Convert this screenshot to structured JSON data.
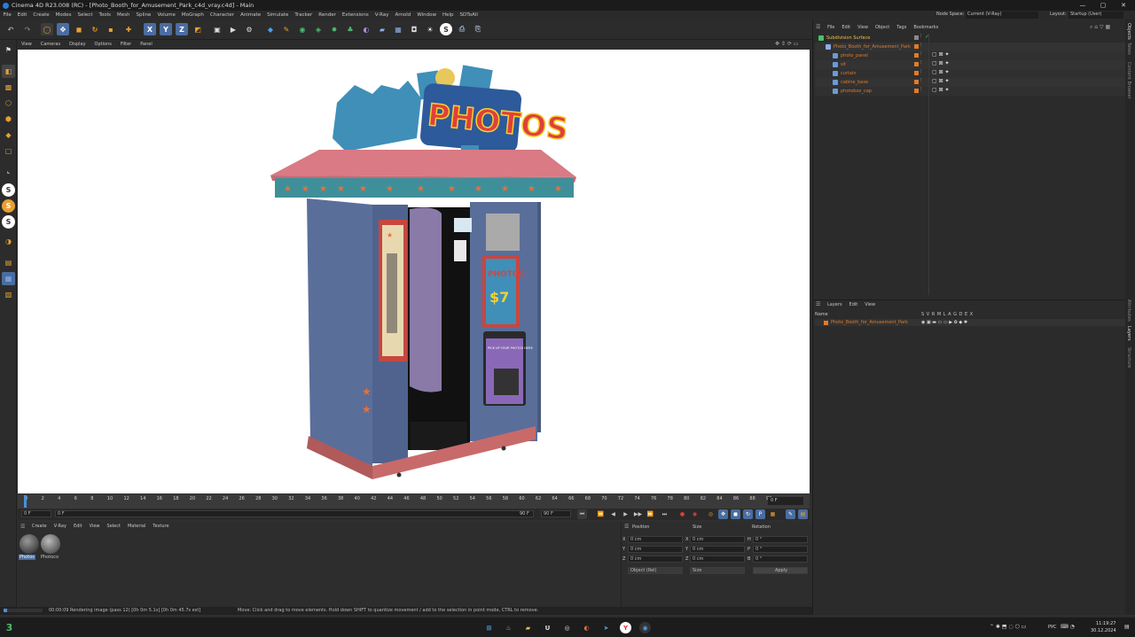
{
  "title": {
    "text": "Cinema 4D R23.008 (RC) - [Photo_Booth_for_Amusement_Park_c4d_vray.c4d] - Main"
  },
  "window_controls": [
    "—",
    "▢",
    "✕"
  ],
  "menu": {
    "items": [
      "File",
      "Edit",
      "Create",
      "Modes",
      "Select",
      "Tools",
      "Mesh",
      "Spline",
      "Volume",
      "MoGraph",
      "Character",
      "Animate",
      "Simulate",
      "Tracker",
      "Render",
      "Extensions",
      "V-Ray",
      "Arnold",
      "Window",
      "Help",
      "SDToAll"
    ],
    "node_space_label": "Node Space:",
    "node_space_value": "Current (V-Ray)",
    "layout_label": "Layout:",
    "layout_value": "Startup (User)"
  },
  "viewport_menu": {
    "items": [
      "View",
      "Cameras",
      "Display",
      "Options",
      "Filter",
      "Panel"
    ]
  },
  "booth": {
    "sign": "PHOTOS",
    "panel_sign": "PHOTOS",
    "panel_price": "$7",
    "pickup": "PICK UP YOUR PHOTOS HERE"
  },
  "timeline": {
    "ticks": [
      "0",
      "2",
      "4",
      "6",
      "8",
      "10",
      "12",
      "14",
      "16",
      "18",
      "20",
      "22",
      "24",
      "26",
      "28",
      "30",
      "32",
      "34",
      "36",
      "38",
      "40",
      "42",
      "44",
      "46",
      "48",
      "50",
      "52",
      "54",
      "56",
      "58",
      "60",
      "62",
      "64",
      "66",
      "68",
      "70",
      "72",
      "74",
      "76",
      "78",
      "80",
      "82",
      "84",
      "86",
      "88",
      "90"
    ],
    "current_frame": "0 F"
  },
  "playback": {
    "start": "0 F",
    "current": "0 F",
    "end_a": "90 F",
    "end_b": "90 F"
  },
  "material_manager": {
    "menu": [
      "Create",
      "V-Ray",
      "Edit",
      "View",
      "Select",
      "Material",
      "Texture"
    ],
    "materials": [
      "Photos",
      "Photoco"
    ]
  },
  "coordinates": {
    "headers": [
      "Position",
      "Size",
      "Rotation"
    ],
    "rows": [
      {
        "axis": "X",
        "pos": "0 cm",
        "size_axis": "X",
        "size": "0 cm",
        "rot_axis": "H",
        "rot": "0 °"
      },
      {
        "axis": "Y",
        "pos": "0 cm",
        "size_axis": "Y",
        "size": "0 cm",
        "rot_axis": "P",
        "rot": "0 °"
      },
      {
        "axis": "Z",
        "pos": "0 cm",
        "size_axis": "Z",
        "size": "0 cm",
        "rot_axis": "B",
        "rot": "0 °"
      }
    ],
    "mode": "Object (Rel)",
    "size_mode": "Size",
    "apply": "Apply"
  },
  "status": {
    "render": "00:00:09 Rendering image (pass 12) [0h 0m 5.1s] [0h 0m 45.7s est]",
    "hint": "Move: Click and drag to move elements. Hold down SHIFT to quantize movement / add to the selection in point mode, CTRL to remove."
  },
  "objects": {
    "menu": [
      "File",
      "Edit",
      "View",
      "Object",
      "Tags",
      "Bookmarks"
    ],
    "items": [
      {
        "name": "Subdivision Surface",
        "indent": 0
      },
      {
        "name": "Photo_Booth_for_Amusement_Park",
        "indent": 1
      },
      {
        "name": "photo_panel",
        "indent": 2
      },
      {
        "name": "sit",
        "indent": 2
      },
      {
        "name": "curtain",
        "indent": 2
      },
      {
        "name": "cabine_base",
        "indent": 2
      },
      {
        "name": "photobox_cap",
        "indent": 2
      }
    ]
  },
  "side_tabs": [
    "Objects",
    "Takes",
    "Content Browser",
    "Attributes",
    "Layers",
    "Structure"
  ],
  "layers": {
    "menu": [
      "Layers",
      "Edit",
      "View"
    ],
    "header_name": "Name",
    "header_cols": "S V R M L A G D E X",
    "items": [
      "Photo_Booth_for_Amusement_Park"
    ]
  },
  "tray": {
    "lang": "РУС",
    "time": "11:19:27",
    "date": "30.12.2024"
  },
  "colors": {
    "accent": "#e07b2a",
    "booth_blue": "#5a6e9a",
    "roof_pink": "#d97a84",
    "trim_teal": "#3f8f9a"
  }
}
